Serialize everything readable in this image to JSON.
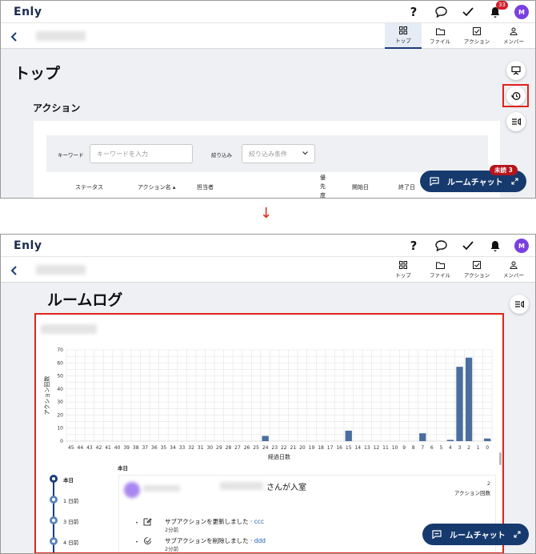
{
  "app": {
    "logo": "Enly",
    "avatar_initial": "M",
    "notification_count": "33"
  },
  "nav_tabs": [
    {
      "label": "トップ",
      "icon": "grid-icon"
    },
    {
      "label": "ファイル",
      "icon": "folder-icon"
    },
    {
      "label": "アクション",
      "icon": "checkbox-icon"
    },
    {
      "label": "メンバー",
      "icon": "person-icon"
    }
  ],
  "before": {
    "page_title": "トップ",
    "section_title": "アクション",
    "filters": {
      "keyword_label": "キーワード",
      "keyword_placeholder": "キーワードを入力",
      "narrow_label": "絞り込み",
      "narrow_placeholder": "絞り込み条件"
    },
    "columns": [
      "ステータス",
      "アクション名 ▴",
      "担当者",
      "優先度",
      "開始日",
      "終了日"
    ],
    "chat_button": "ルームチャット",
    "unread_badge": "未読 3"
  },
  "after": {
    "page_title": "ルームログ",
    "chat_button": "ルームチャット"
  },
  "chart_data": {
    "type": "bar",
    "title": "",
    "xlabel": "経過日数",
    "ylabel": "アクション回数",
    "ylim": [
      0,
      70
    ],
    "yticks": [
      0,
      10,
      20,
      30,
      40,
      50,
      60,
      70
    ],
    "categories": [
      "45",
      "44",
      "43",
      "42",
      "41",
      "40",
      "39",
      "38",
      "37",
      "36",
      "35",
      "34",
      "33",
      "32",
      "31",
      "30",
      "29",
      "28",
      "27",
      "26",
      "25",
      "24",
      "23",
      "22",
      "21",
      "20",
      "19",
      "18",
      "17",
      "16",
      "15",
      "14",
      "13",
      "12",
      "11",
      "10",
      "9",
      "8",
      "7",
      "6",
      "5",
      "4",
      "3",
      "2",
      "1",
      "0"
    ],
    "values": [
      0,
      0,
      0,
      0,
      0,
      0,
      0,
      0,
      0,
      0,
      0,
      0,
      0,
      0,
      0,
      0,
      0,
      0,
      0,
      0,
      0,
      4,
      0,
      0,
      0,
      0,
      0,
      0,
      0,
      0,
      8,
      0,
      0,
      0,
      0,
      0,
      0,
      0,
      6,
      0,
      0,
      1,
      57,
      64,
      0,
      2
    ],
    "grid": true,
    "color": "#4a6e9e"
  },
  "log": {
    "timeline": [
      "本日",
      "1 日前",
      "3 日前",
      "4 日前"
    ],
    "day_header": "本日",
    "entry_title": "さんが入室",
    "entry_count": "2",
    "entry_count_label": "アクション回数",
    "items": [
      {
        "text": "サブアクションを更新しました · ",
        "link": "ccc",
        "time": "2分前"
      },
      {
        "text": "サブアクションを削除しました · ",
        "link": "ddd",
        "time": "2分前"
      }
    ]
  }
}
